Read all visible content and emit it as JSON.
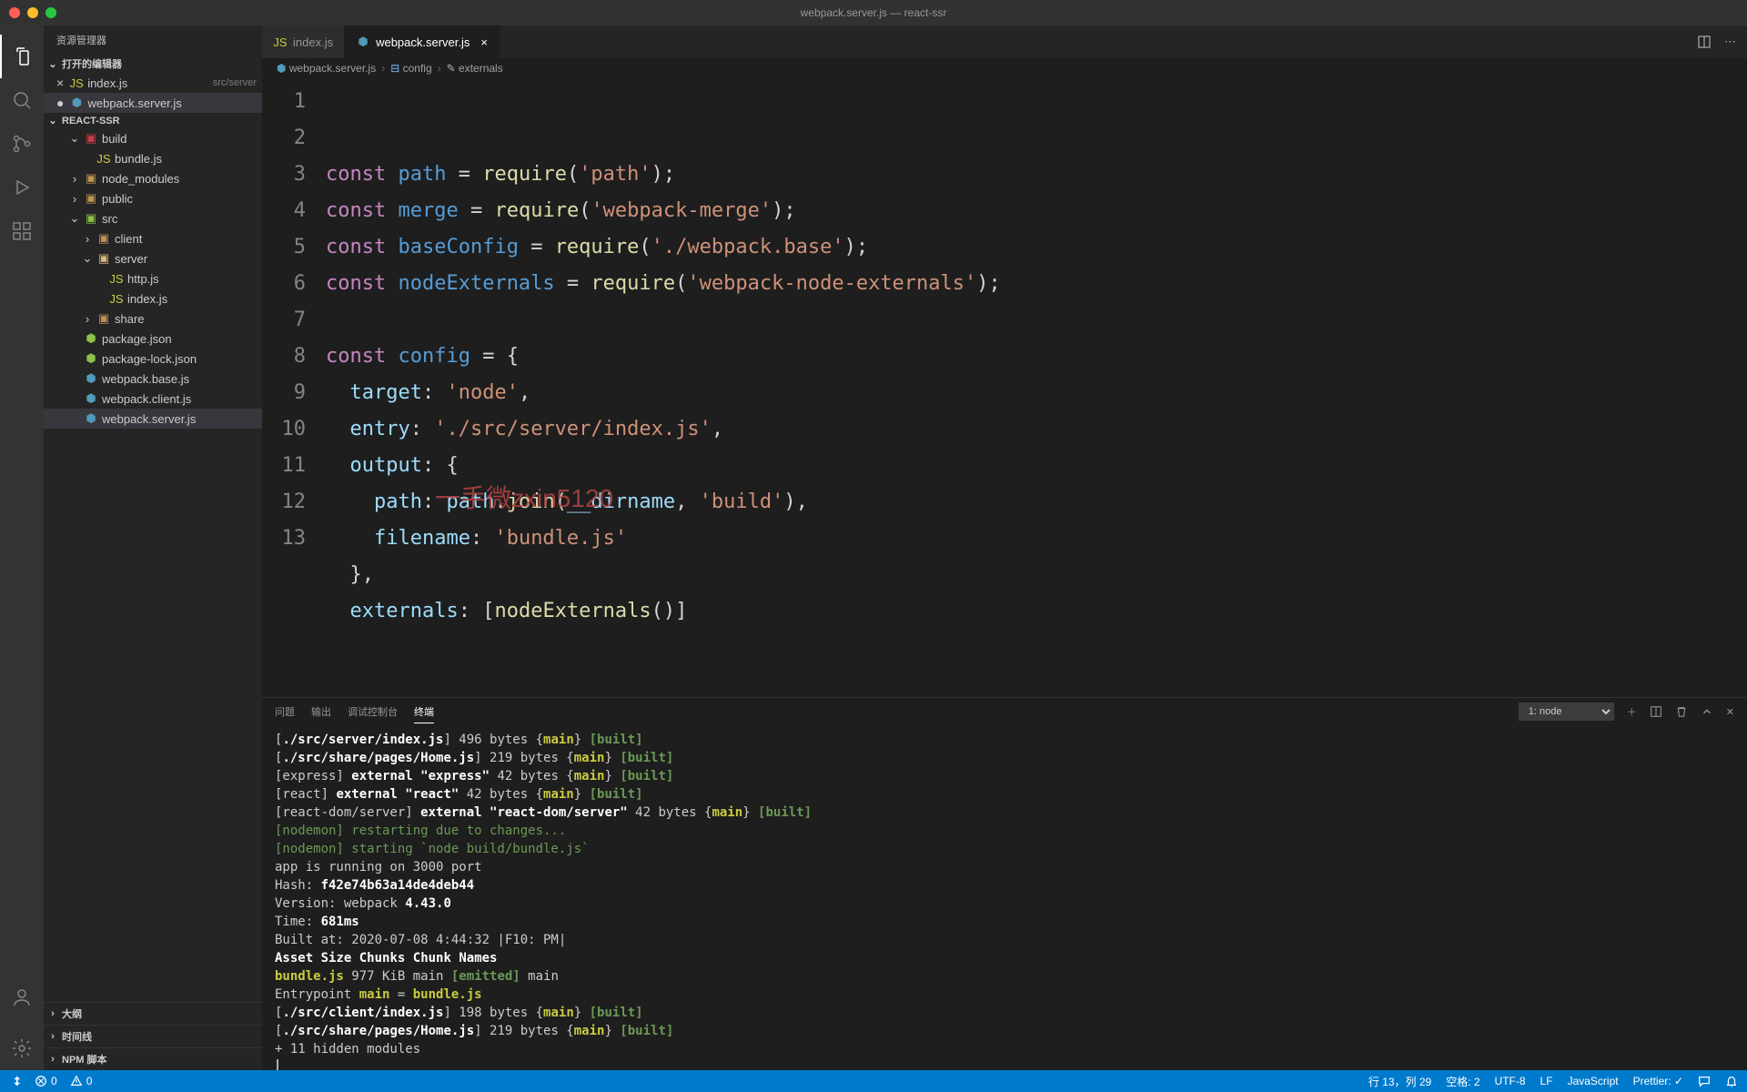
{
  "titlebar": {
    "title": "webpack.server.js — react-ssr"
  },
  "sidebar": {
    "title": "资源管理器",
    "openEditorsHeader": "打开的编辑器",
    "openEditors": [
      {
        "name": "index.js",
        "desc": "src/server",
        "iconClass": "fi-js",
        "modified": false
      },
      {
        "name": "webpack.server.js",
        "desc": "",
        "iconClass": "fi-webpack",
        "modified": true
      }
    ],
    "projectHeader": "REACT-SSR",
    "tree": [
      {
        "depth": 1,
        "kind": "folder-open",
        "iconClass": "fi-folder-red",
        "name": "build",
        "chev": "⌄"
      },
      {
        "depth": 2,
        "kind": "file",
        "iconClass": "fi-js",
        "name": "bundle.js"
      },
      {
        "depth": 1,
        "kind": "folder",
        "iconClass": "fi-folder",
        "name": "node_modules",
        "chev": "›"
      },
      {
        "depth": 1,
        "kind": "folder",
        "iconClass": "fi-folder",
        "name": "public",
        "chev": "›"
      },
      {
        "depth": 1,
        "kind": "folder-open",
        "iconClass": "fi-folder-src",
        "name": "src",
        "chev": "⌄"
      },
      {
        "depth": 2,
        "kind": "folder",
        "iconClass": "fi-folder",
        "name": "client",
        "chev": "›"
      },
      {
        "depth": 2,
        "kind": "folder-open",
        "iconClass": "fi-folder-open",
        "name": "server",
        "chev": "⌄"
      },
      {
        "depth": 3,
        "kind": "file",
        "iconClass": "fi-js",
        "name": "http.js"
      },
      {
        "depth": 3,
        "kind": "file",
        "iconClass": "fi-js",
        "name": "index.js"
      },
      {
        "depth": 2,
        "kind": "folder",
        "iconClass": "fi-folder",
        "name": "share",
        "chev": "›"
      },
      {
        "depth": 1,
        "kind": "file",
        "iconClass": "fi-pkg",
        "name": "package.json"
      },
      {
        "depth": 1,
        "kind": "file",
        "iconClass": "fi-pkg",
        "name": "package-lock.json"
      },
      {
        "depth": 1,
        "kind": "file",
        "iconClass": "fi-webpack",
        "name": "webpack.base.js"
      },
      {
        "depth": 1,
        "kind": "file",
        "iconClass": "fi-webpack",
        "name": "webpack.client.js"
      },
      {
        "depth": 1,
        "kind": "file",
        "iconClass": "fi-webpack",
        "name": "webpack.server.js",
        "selected": true
      }
    ],
    "footer": [
      {
        "label": "大纲"
      },
      {
        "label": "时间线"
      },
      {
        "label": "NPM 脚本"
      }
    ]
  },
  "tabs": [
    {
      "label": "index.js",
      "iconClass": "fi-js",
      "active": false
    },
    {
      "label": "webpack.server.js",
      "iconClass": "fi-webpack",
      "active": true,
      "closeVisible": true
    }
  ],
  "breadcrumbs": [
    {
      "icon": "fi-webpack",
      "label": "webpack.server.js"
    },
    {
      "icon": "cube",
      "label": "config"
    },
    {
      "icon": "wrench",
      "label": "externals"
    }
  ],
  "code": {
    "lines": 13,
    "src": [
      [
        [
          "kw",
          "const"
        ],
        [
          "sp",
          " "
        ],
        [
          "var",
          "path"
        ],
        [
          "sp",
          " "
        ],
        [
          "punc",
          "="
        ],
        [
          "sp",
          " "
        ],
        [
          "fn",
          "require"
        ],
        [
          "punc",
          "("
        ],
        [
          "str",
          "'path'"
        ],
        [
          "punc",
          ");"
        ]
      ],
      [
        [
          "kw",
          "const"
        ],
        [
          "sp",
          " "
        ],
        [
          "var",
          "merge"
        ],
        [
          "sp",
          " "
        ],
        [
          "punc",
          "="
        ],
        [
          "sp",
          " "
        ],
        [
          "fn",
          "require"
        ],
        [
          "punc",
          "("
        ],
        [
          "str",
          "'webpack-merge'"
        ],
        [
          "punc",
          ");"
        ]
      ],
      [
        [
          "kw",
          "const"
        ],
        [
          "sp",
          " "
        ],
        [
          "var",
          "baseConfig"
        ],
        [
          "sp",
          " "
        ],
        [
          "punc",
          "="
        ],
        [
          "sp",
          " "
        ],
        [
          "fn",
          "require"
        ],
        [
          "punc",
          "("
        ],
        [
          "str",
          "'./webpack.base'"
        ],
        [
          "punc",
          ");"
        ]
      ],
      [
        [
          "kw",
          "const"
        ],
        [
          "sp",
          " "
        ],
        [
          "var",
          "nodeExternals"
        ],
        [
          "sp",
          " "
        ],
        [
          "punc",
          "="
        ],
        [
          "sp",
          " "
        ],
        [
          "fn",
          "require"
        ],
        [
          "punc",
          "("
        ],
        [
          "str",
          "'webpack-node-externals'"
        ],
        [
          "punc",
          ");"
        ]
      ],
      [],
      [
        [
          "kw",
          "const"
        ],
        [
          "sp",
          " "
        ],
        [
          "var",
          "config"
        ],
        [
          "sp",
          " "
        ],
        [
          "punc",
          "="
        ],
        [
          "sp",
          " "
        ],
        [
          "punc",
          "{"
        ]
      ],
      [
        [
          "sp",
          "  "
        ],
        [
          "prop",
          "target"
        ],
        [
          "punc",
          ":"
        ],
        [
          "sp",
          " "
        ],
        [
          "str",
          "'node'"
        ],
        [
          "punc",
          ","
        ]
      ],
      [
        [
          "sp",
          "  "
        ],
        [
          "prop",
          "entry"
        ],
        [
          "punc",
          ":"
        ],
        [
          "sp",
          " "
        ],
        [
          "str",
          "'./src/server/index.js'"
        ],
        [
          "punc",
          ","
        ]
      ],
      [
        [
          "sp",
          "  "
        ],
        [
          "prop",
          "output"
        ],
        [
          "punc",
          ":"
        ],
        [
          "sp",
          " "
        ],
        [
          "punc",
          "{"
        ]
      ],
      [
        [
          "sp",
          "    "
        ],
        [
          "prop",
          "path"
        ],
        [
          "punc",
          ":"
        ],
        [
          "sp",
          " "
        ],
        [
          "id",
          "path"
        ],
        [
          "punc",
          "."
        ],
        [
          "fn",
          "join"
        ],
        [
          "punc",
          "("
        ],
        [
          "id",
          "__dirname"
        ],
        [
          "punc",
          ", "
        ],
        [
          "str",
          "'build'"
        ],
        [
          "punc",
          "),"
        ]
      ],
      [
        [
          "sp",
          "    "
        ],
        [
          "prop",
          "filename"
        ],
        [
          "punc",
          ":"
        ],
        [
          "sp",
          " "
        ],
        [
          "str",
          "'bundle.js'"
        ]
      ],
      [
        [
          "sp",
          "  "
        ],
        [
          "punc",
          "},"
        ]
      ],
      [
        [
          "sp",
          "  "
        ],
        [
          "prop",
          "externals"
        ],
        [
          "punc",
          ":"
        ],
        [
          "sp",
          " "
        ],
        [
          "punc",
          "["
        ],
        [
          "fn",
          "nodeExternals"
        ],
        [
          "punc",
          "()]"
        ]
      ]
    ]
  },
  "watermark": "一手微zxin5120",
  "panel": {
    "tabs": [
      "问题",
      "输出",
      "调试控制台",
      "终端"
    ],
    "activeTab": 3,
    "terminalSelect": "1: node"
  },
  "terminal": [
    "[<b>./src/server/index.js</b>] 496 bytes {<y>main</y>} <g>[built]</g>",
    "[<b>./src/share/pages/Home.js</b>] 219 bytes {<y>main</y>} <g>[built]</g>",
    "[express] <b>external \"express\"</b> 42 bytes {<y>main</y>} <g>[built]</g>",
    "[react] <b>external \"react\"</b> 42 bytes {<y>main</y>} <g>[built]</g>",
    "[react-dom/server] <b>external \"react-dom/server\"</b> 42 bytes {<y>main</y>} <g>[built]</g>",
    "<gl>[nodemon] restarting due to changes...</gl>",
    "<gl>[nodemon] starting `node build/bundle.js`</gl>",
    "app is running on 3000 port",
    "Hash: <b>f42e74b63a14de4deb44</b>",
    "Version: webpack <b>4.43.0</b>",
    "Time: <b>681ms</b>",
    "Built at: 2020-07-08 4:44:32 |F10: PM|",
    "       <b>Asset</b>    <b>Size</b>  <b>Chunks</b>             <b>Chunk Names</b>",
    "<yl>bundle.js</yl>  977 KiB    main  <g>[emitted]</g>  main",
    "Entrypoint <y>main</y> = <yl>bundle.js</yl>",
    "[<b>./src/client/index.js</b>] 198 bytes {<y>main</y>} <g>[built]</g>",
    "[<b>./src/share/pages/Home.js</b>] 219 bytes {<y>main</y>} <g>[built]</g>",
    "    + 11 hidden modules"
  ],
  "statusbar": {
    "branch": "",
    "errors": "0",
    "warnings": "0",
    "lineCol": "行 13，列 29",
    "spaces": "空格: 2",
    "encoding": "UTF-8",
    "eol": "LF",
    "lang": "JavaScript",
    "prettier": "Prettier: ✓",
    "bell": ""
  }
}
